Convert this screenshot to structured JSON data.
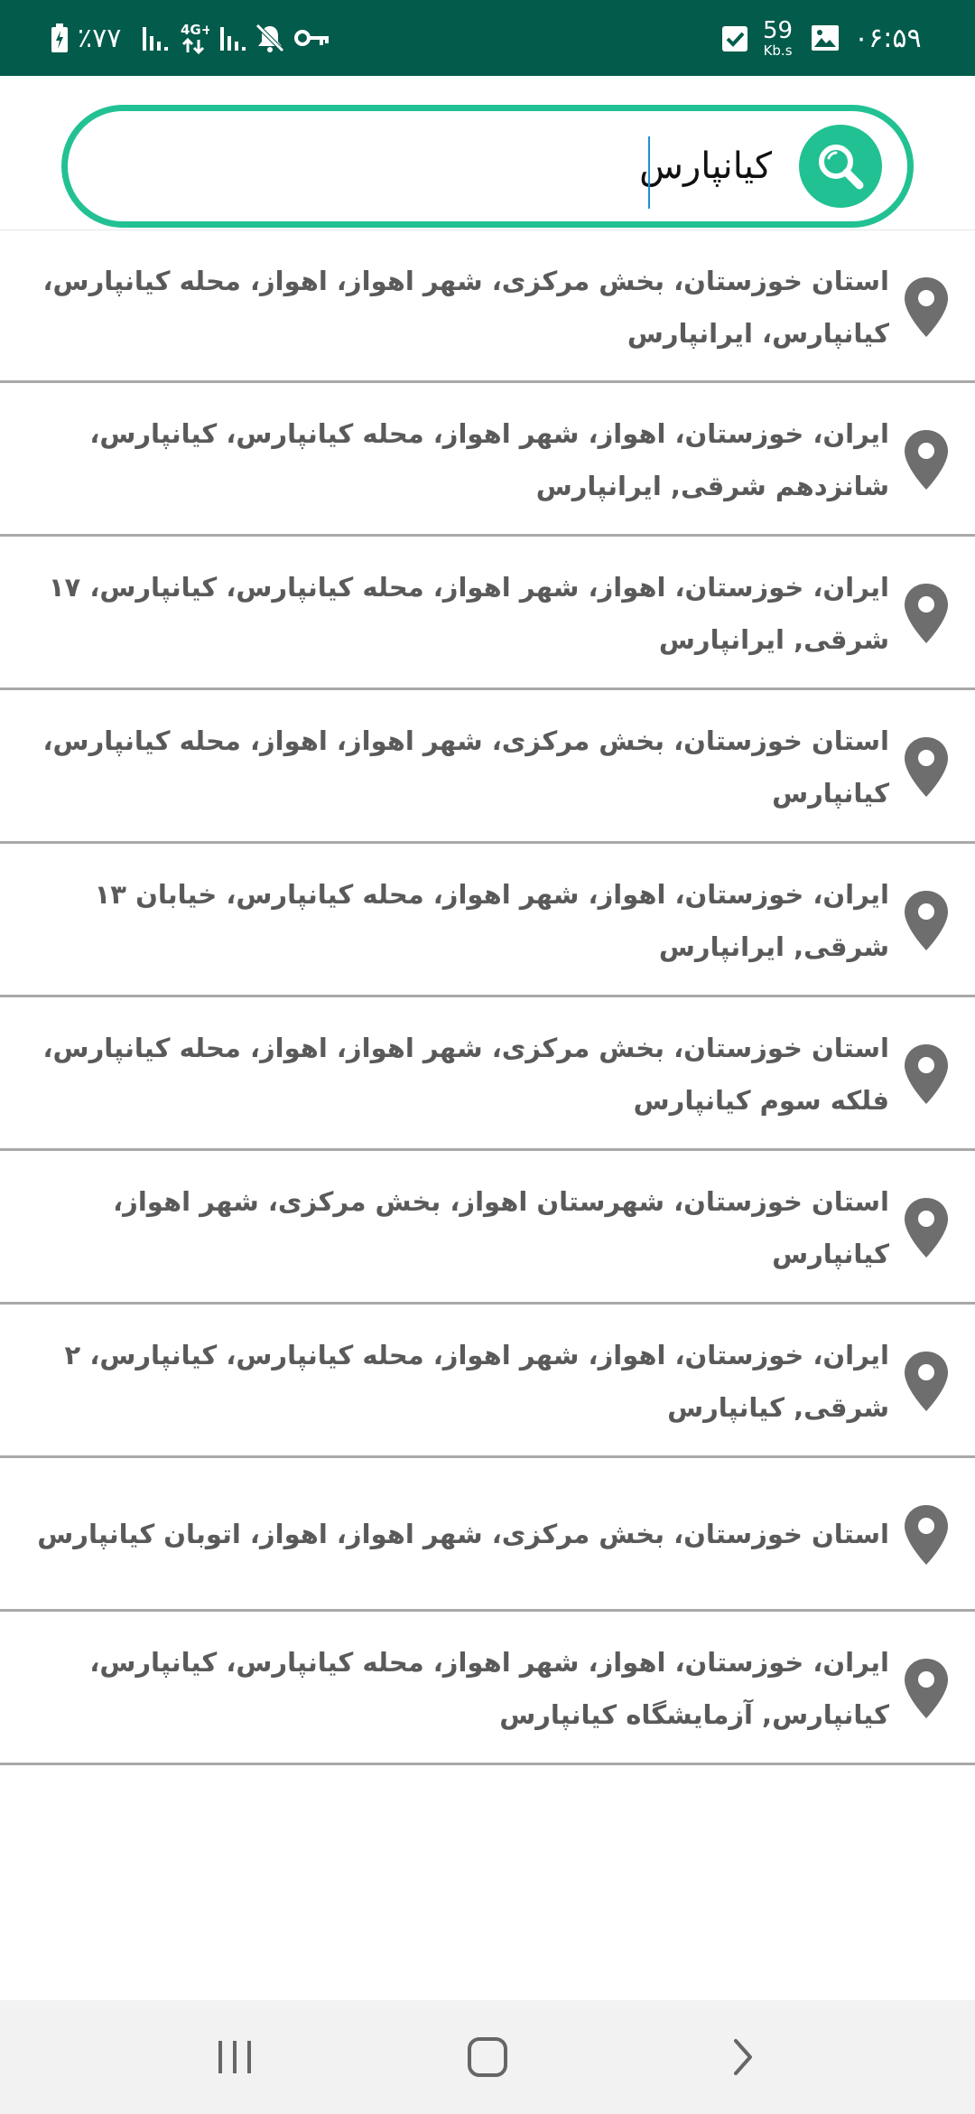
{
  "status_bar": {
    "time": "۰۶:۵۹",
    "net_speed_value": "59",
    "net_speed_unit": "Kb.s",
    "battery_percent": "٪۷۷",
    "icons": [
      "checkbox-notification-icon",
      "gallery-icon",
      "battery-charging-icon",
      "signal-icon",
      "4g-data-icon",
      "signal-icon",
      "mute-icon",
      "vpn-key-icon"
    ]
  },
  "search": {
    "value": "کیانپارس",
    "icon": "search-icon",
    "accent_color": "#22c193"
  },
  "results": [
    {
      "address": "استان خوزستان، بخش مرکزی، شهر اهواز، اهواز، محله کیانپارس، کیانپارس،  ایرانپارس"
    },
    {
      "address": "ایران، خوزستان، اهواز، شهر اهواز، محله کیانپارس، کیانپارس، شانزدهم شرقی, ایرانپارس"
    },
    {
      "address": "ایران، خوزستان، اهواز، شهر اهواز، محله کیانپارس، کیانپارس، ۱۷ شرقی, ایرانپارس"
    },
    {
      "address": "استان خوزستان، بخش مرکزی، شهر اهواز، اهواز، محله کیانپارس، کیانپارس"
    },
    {
      "address": "ایران، خوزستان، اهواز، شهر اهواز، محله کیانپارس، خیابان ۱۳ شرقی, ایرانپارس"
    },
    {
      "address": "استان خوزستان، بخش مرکزی، شهر اهواز، اهواز، محله کیانپارس، فلکه سوم کیانپارس"
    },
    {
      "address": "استان خوزستان، شهرستان اهواز، بخش مرکزی، شهر اهواز، کیانپارس"
    },
    {
      "address": "ایران، خوزستان، اهواز، شهر اهواز، محله کیانپارس، کیانپارس، ۲ شرقی, کیانپارس"
    },
    {
      "address": "استان خوزستان، بخش مرکزی، شهر اهواز، اهواز، اتوبان کیانپارس"
    },
    {
      "address": "ایران، خوزستان، اهواز، شهر اهواز، محله کیانپارس، کیانپارس، کیانپارس, آزمایشگاه کیانپارس"
    }
  ],
  "result_icon": "location-pin-icon",
  "nav_bar": {
    "buttons": [
      "recent-apps-icon",
      "home-icon",
      "back-icon"
    ]
  }
}
